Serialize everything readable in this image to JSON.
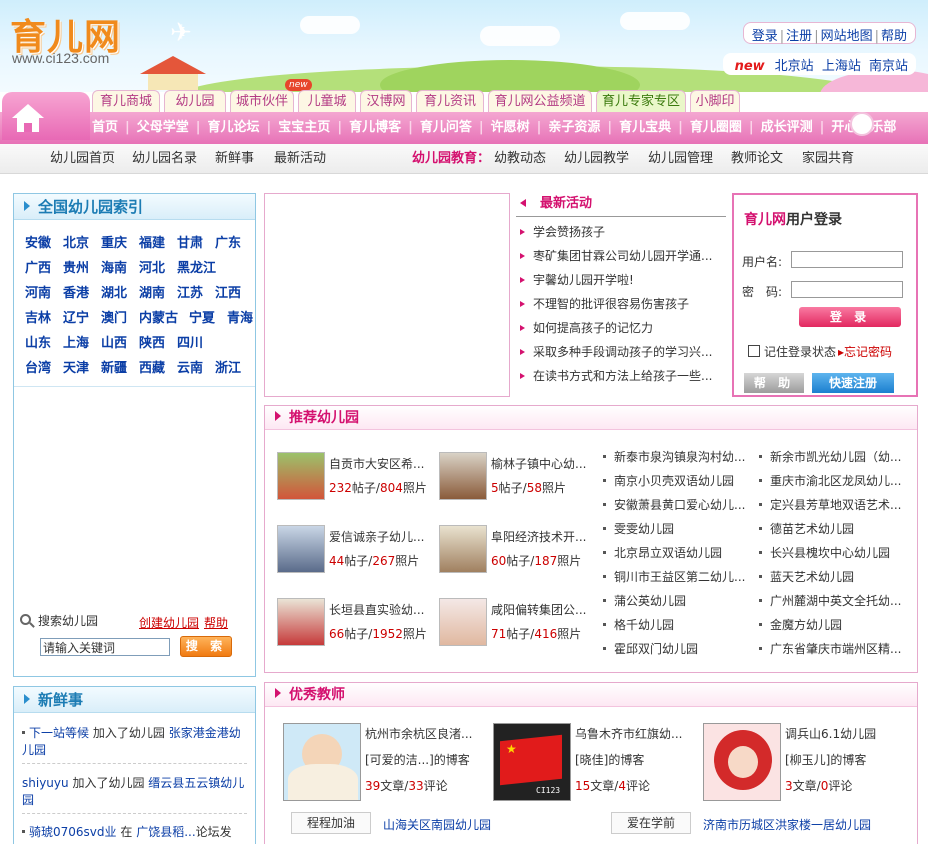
{
  "header": {
    "logo_text": "育儿网",
    "logo_url": "www.ci123.com",
    "top_links": [
      "登录",
      "注册",
      "网站地图",
      "帮助"
    ],
    "city_new": "new",
    "cities": [
      "北京站",
      "上海站",
      "南京站"
    ]
  },
  "tabs": {
    "badge": "new",
    "items": [
      "育儿商城",
      "幼儿园",
      "城市伙伴",
      "儿童城",
      "汉博网",
      "育儿资讯",
      "育儿网公益频道",
      "育儿专家专区",
      "小脚印"
    ]
  },
  "mainnav": [
    "首页",
    "父母学堂",
    "育儿论坛",
    "宝宝主页",
    "育儿博客",
    "育儿问答",
    "许愿树",
    "亲子资源",
    "育儿宝典",
    "育儿圈圈",
    "成长评测",
    "开心俱乐部"
  ],
  "subnav": {
    "left": [
      "幼儿园首页",
      "幼儿园名录",
      "新鲜事",
      "最新活动"
    ],
    "label": "幼儿园教育：",
    "right": [
      "幼教动态",
      "幼儿园教学",
      "幼儿园管理",
      "教师论文",
      "家园共育"
    ]
  },
  "index": {
    "title": "全国幼儿园索引",
    "provinces": [
      "安徽",
      "北京",
      "重庆",
      "福建",
      "甘肃",
      "广东",
      "广西",
      "贵州",
      "海南",
      "河北",
      "黑龙江",
      "河南",
      "香港",
      "湖北",
      "湖南",
      "江苏",
      "江西",
      "吉林",
      "辽宁",
      "澳门",
      "内蒙古",
      "宁夏",
      "青海",
      "山东",
      "上海",
      "山西",
      "陕西",
      "四川",
      "台湾",
      "天津",
      "新疆",
      "西藏",
      "云南",
      "浙江"
    ],
    "search_label": "搜索幼儿园",
    "create_link": "创建幼儿园",
    "help_link": "帮助",
    "search_value": "请输入关键词",
    "search_button": "搜 索"
  },
  "fresh": {
    "title": "新鲜事",
    "items": [
      {
        "user": "下一站等候",
        "action": "加入了幼儿园",
        "target": "张家港金港幼儿园"
      },
      {
        "user": "shiyuyu",
        "action": "加入了幼儿园",
        "target": "缙云县五云镇幼儿园"
      },
      {
        "user": "骑琥0706svd业",
        "action": "在",
        "target": "广饶县稻...",
        "tail": "论坛发"
      }
    ]
  },
  "activities": {
    "title": "最新活动",
    "items": [
      "学会赞扬孩子",
      "枣矿集团甘霖公司幼儿园开学通...",
      "宇馨幼儿园开学啦!",
      "不理智的批评很容易伤害孩子",
      "如何提高孩子的记忆力",
      "采取多种手段调动孩子的学习兴...",
      "在读书方式和方法上给孩子一些..."
    ]
  },
  "login": {
    "brand": "育儿网",
    "title": "用户登录",
    "username_label": "用户名:",
    "password_label": "密　码:",
    "login_button": "登 录",
    "remember_label": "记住登录状态",
    "forgot": "忘记密码",
    "help_button": "帮 助",
    "register_button": "快速注册"
  },
  "recommend": {
    "title": "推荐幼儿园",
    "featured": [
      {
        "name": "自贡市大安区希...",
        "posts": "232",
        "photos": "804"
      },
      {
        "name": "榆林子镇中心幼...",
        "posts": "5",
        "photos": "58"
      },
      {
        "name": "爱信诚亲子幼儿...",
        "posts": "44",
        "photos": "267"
      },
      {
        "name": "阜阳经济技术开...",
        "posts": "60",
        "photos": "187"
      },
      {
        "name": "长垣县直实验幼...",
        "posts": "66",
        "photos": "1952"
      },
      {
        "name": "咸阳偏转集团公...",
        "posts": "71",
        "photos": "416"
      }
    ],
    "post_unit": "帖子/",
    "photo_unit": "照片",
    "list_a": [
      "新泰市泉沟镇泉沟村幼...",
      "南京小贝壳双语幼儿园",
      "安徽萧县黄口爱心幼儿...",
      "雯雯幼儿园",
      "北京昂立双语幼儿园",
      "铜川市王益区第二幼儿...",
      "蒲公英幼儿园",
      "格千幼儿园",
      "霍邱双门幼儿园"
    ],
    "list_b": [
      "新余市凯光幼儿园（幼...",
      "重庆市渝北区龙凤幼儿...",
      "定兴县芳草地双语艺术...",
      "德苗艺术幼儿园",
      "长兴县槐坎中心幼儿园",
      "蓝天艺术幼儿园",
      "广州麓湖中英文全托幼...",
      "金魔方幼儿园",
      "广东省肇庆市端州区精..."
    ]
  },
  "teachers": {
    "title": "优秀教师",
    "items": [
      {
        "name": "杭州市余杭区良渚...",
        "blog": "[可爱的洁...]的博客",
        "articles": "39",
        "comments": "33"
      },
      {
        "name": "乌鲁木齐市红旗幼...",
        "blog": "[晓佳]的博客",
        "articles": "15",
        "comments": "4"
      },
      {
        "name": "调兵山6.1幼儿园",
        "blog": "[柳玉儿]的博客",
        "articles": "3",
        "comments": "0"
      }
    ],
    "article_unit": "文章/",
    "comment_unit": "评论",
    "watermark": "CI123",
    "tags": [
      {
        "label": "程程加油",
        "link": "山海关区南园幼儿园"
      },
      {
        "label": "爱在学前",
        "link": "济南市历城区洪家楼一居幼儿园"
      }
    ]
  },
  "colors": {
    "pink": "#e772b7",
    "blue": "#1c7cb4",
    "link": "#0b3ea6",
    "red": "#c00"
  }
}
